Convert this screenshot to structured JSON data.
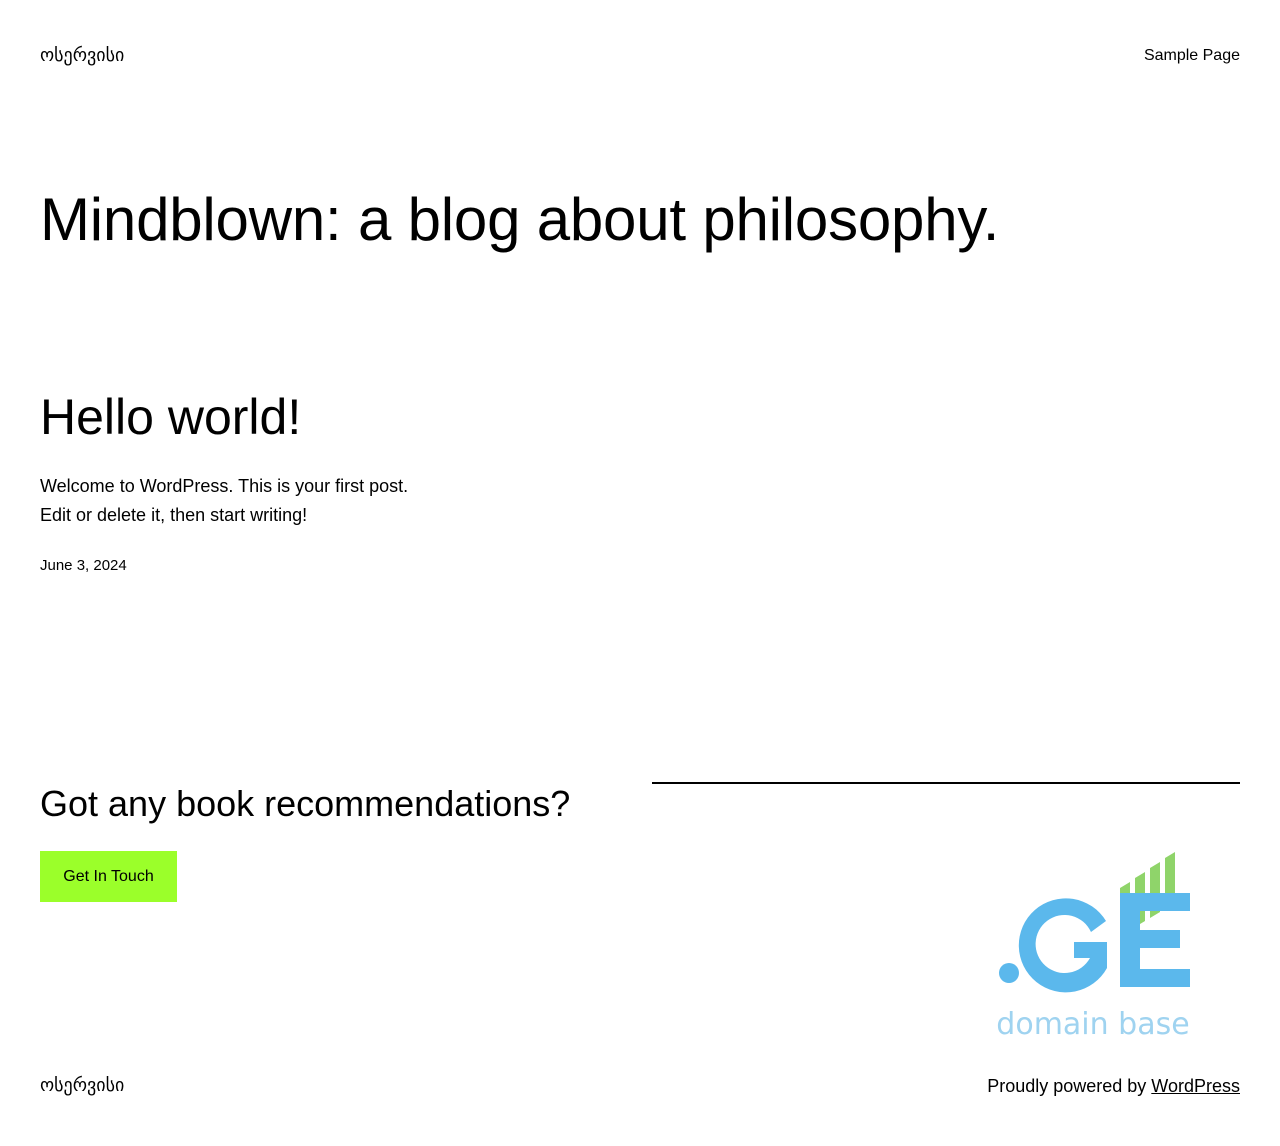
{
  "header": {
    "site_title": "ოსერვისი",
    "nav_items": [
      {
        "label": "Sample Page"
      }
    ]
  },
  "hero": {
    "title": "Mindblown: a blog about philosophy."
  },
  "posts": [
    {
      "title": "Hello world!",
      "excerpt": "Welcome to WordPress. This is your first post. Edit or delete it, then start writing!",
      "date": "June 3, 2024"
    }
  ],
  "cta": {
    "heading": "Got any book recommendations?",
    "button_label": "Get In Touch",
    "button_color": "#9bff2a"
  },
  "logo": {
    "mark_text": ".GE",
    "tagline": "domain base",
    "brand_blue": "#5bb8ec",
    "brand_green": "#8fd46a"
  },
  "footer": {
    "site_title": "ოსერვისი",
    "powered_prefix": "Proudly powered by ",
    "powered_link": "WordPress"
  }
}
